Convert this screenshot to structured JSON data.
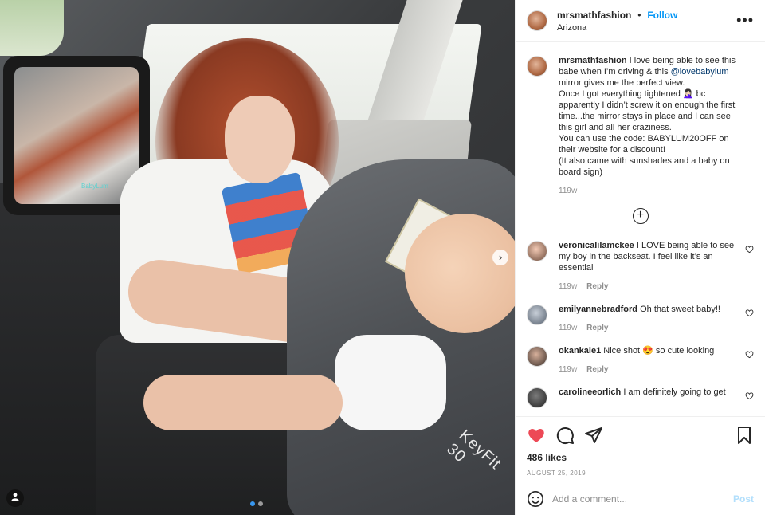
{
  "photo": {
    "mirror_brand": "BabyLum",
    "seat_brand": "KeyFit 30",
    "next_icon": "chevron-right-icon",
    "tag_icon": "person-tag-icon",
    "carousel_dots": 2,
    "active_dot": 0
  },
  "header": {
    "username": "mrsmathfashion",
    "separator": "•",
    "follow_label": "Follow",
    "location": "Arizona",
    "more_icon": "more-options-icon",
    "more_label": "•••"
  },
  "caption": {
    "username": "mrsmathfashion",
    "text": " I love being able to see this babe when I’m driving & this ",
    "mention": "@lovebabylum",
    "text2": " mirror gives me the perfect view.\nOnce I got everything tightened 🤦🏻‍♀️ bc apparently I didn’t screw it on enough the first time...the mirror stays in place and I can see this girl and all her craziness.\nYou can use the code: BABYLUM20OFF on their website for a discount!\n(It also came with sunshades and a baby on board sign)",
    "time": "119w"
  },
  "load_more": "+",
  "comments": [
    {
      "username": "veronicalilamckee",
      "text": " I LOVE being able to see my boy in the backseat. I feel like it’s an essential",
      "time": "119w",
      "reply": "Reply"
    },
    {
      "username": "emilyannebradford",
      "text": " Oh that sweet baby!!",
      "time": "119w",
      "reply": "Reply"
    },
    {
      "username": "okankale1",
      "text": " Nice shot 😍 so cute looking",
      "time": "119w",
      "reply": "Reply"
    },
    {
      "username": "carolineeorlich",
      "text": " I am definitely going to get",
      "time": "",
      "reply": ""
    }
  ],
  "actions": {
    "liked": true,
    "like_color": "#ed4956",
    "likes": "486 likes",
    "date": "AUGUST 25, 2019"
  },
  "add_comment": {
    "placeholder": "Add a comment...",
    "post_label": "Post",
    "emoji_icon": "smiley-icon"
  }
}
